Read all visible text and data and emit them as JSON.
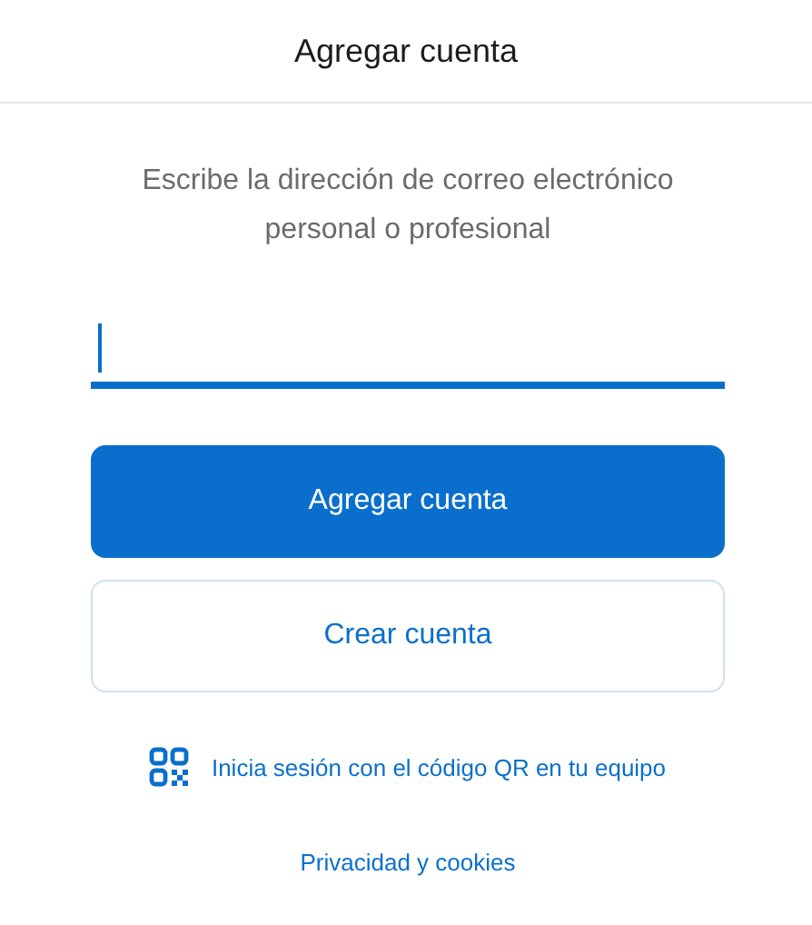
{
  "header": {
    "title": "Agregar cuenta"
  },
  "prompt": "Escribe la dirección de correo electrónico personal o profesional",
  "email_field": {
    "focused": true
  },
  "buttons": [
    {
      "label": "Agregar cuenta",
      "kind": "primary"
    },
    {
      "label": "Crear cuenta",
      "kind": "secondary"
    }
  ],
  "qr_link": "Inicia sesión con el código QR en tu equipo",
  "privacy_link": "Privacidad y cookies"
}
